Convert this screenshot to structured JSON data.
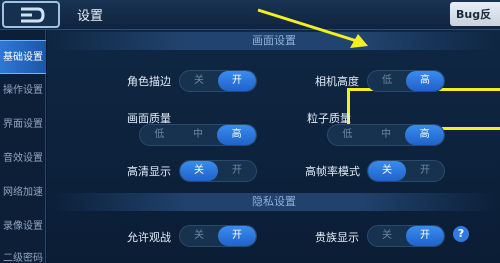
{
  "header": {
    "title": "设置",
    "bug_label": "Bug反"
  },
  "sidebar": {
    "items": [
      {
        "label": "基础设置",
        "active": true
      },
      {
        "label": "操作设置"
      },
      {
        "label": "界面设置"
      },
      {
        "label": "音效设置"
      },
      {
        "label": "网络加速"
      },
      {
        "label": "录像设置"
      },
      {
        "label": "二级密码"
      }
    ]
  },
  "sections": {
    "graphics": "画面设置",
    "privacy": "隐私设置"
  },
  "settings": {
    "role_outline": {
      "label": "角色描边",
      "options": [
        "关",
        "开"
      ],
      "selected": "开"
    },
    "camera_height": {
      "label": "相机高度",
      "options": [
        "低",
        "高"
      ],
      "selected": "高"
    },
    "picture_quality": {
      "label": "画面质量",
      "options": [
        "低",
        "中",
        "高"
      ],
      "selected": "高"
    },
    "particle_quality": {
      "label": "粒子质量",
      "options": [
        "低",
        "中",
        "高"
      ],
      "selected": "高"
    },
    "hd_display": {
      "label": "高清显示",
      "options": [
        "关",
        "开"
      ],
      "selected": "关"
    },
    "high_fps": {
      "label": "高帧率模式",
      "options": [
        "关",
        "开"
      ],
      "selected": "关"
    },
    "allow_spectate": {
      "label": "允许观战",
      "options": [
        "关",
        "开"
      ],
      "selected": "开"
    },
    "noble_display": {
      "label": "贵族显示",
      "options": [
        "关",
        "开"
      ],
      "selected": "开"
    }
  },
  "help_label": "?",
  "colors": {
    "accent": "#2f78d6",
    "highlight": "#f4f020"
  }
}
